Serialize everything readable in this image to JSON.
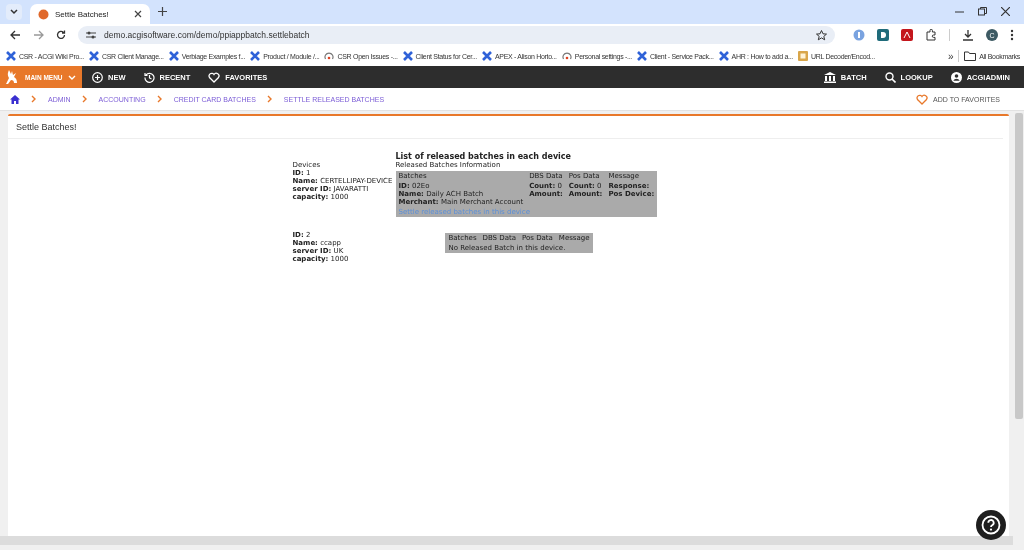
{
  "browser": {
    "tab_title": "Settle Batches!",
    "url": "demo.acgisoftware.com/demo/ppiappbatch.settlebatch",
    "bookmarks": [
      {
        "label": "CSR - ACGI Wiki Pro...",
        "kind": "cross"
      },
      {
        "label": "CSR Client Manage...",
        "kind": "cross"
      },
      {
        "label": "Verbiage Examples f...",
        "kind": "cross"
      },
      {
        "label": "Product / Module /...",
        "kind": "cross"
      },
      {
        "label": "CSR Open Issues -...",
        "kind": "arc"
      },
      {
        "label": "Client Status for Cer...",
        "kind": "cross"
      },
      {
        "label": "APEX - Alison Horto...",
        "kind": "cross"
      },
      {
        "label": "Personal settings -...",
        "kind": "arc"
      },
      {
        "label": "Client - Service Pack...",
        "kind": "cross"
      },
      {
        "label": "AHR : How to add a...",
        "kind": "cross"
      },
      {
        "label": "URL Decoder/Encod...",
        "kind": "square"
      }
    ],
    "more": "»",
    "all_bookmarks": "All Bookmarks",
    "profile": "C"
  },
  "nav": {
    "main_menu": "MAIN MENU",
    "left": [
      {
        "label": "NEW",
        "kind": "plus"
      },
      {
        "label": "RECENT",
        "kind": "history"
      },
      {
        "label": "FAVORITES",
        "kind": "heart"
      }
    ],
    "right": [
      {
        "label": "BATCH",
        "kind": "bank"
      },
      {
        "label": "LOOKUP",
        "kind": "search"
      },
      {
        "label": "ACGIADMIN",
        "kind": "user"
      }
    ]
  },
  "breadcrumb": [
    "ADMIN",
    "ACCOUNTING",
    "CREDIT CARD BATCHES",
    "SETTLE RELEASED BATCHES"
  ],
  "add_to_favorites": "ADD TO FAVORITES",
  "panel": {
    "title": "Settle Batches!",
    "heading": "List of released batches in each device",
    "devices_label": "Devices",
    "info_label": "Released Batches Information",
    "devices": [
      {
        "fields": [
          {
            "label": "ID:",
            "value": "1"
          },
          {
            "label": "Name:",
            "value": "CERTELLIPAY-DEVICE"
          },
          {
            "label": "server ID:",
            "value": "JAVARATTI"
          },
          {
            "label": "capacity:",
            "value": "1000"
          }
        ],
        "columns": [
          "Batches",
          "DBS Data",
          "Pos Data",
          "Message"
        ],
        "batches": [
          {
            "batch": [
              {
                "label": "ID:",
                "value": "02Eo"
              },
              {
                "label": "Name:",
                "value": "Daily ACH Batch"
              },
              {
                "label": "Merchant:",
                "value": "Main Merchant Account"
              }
            ],
            "dbs": [
              {
                "label": "Count:",
                "value": "0"
              },
              {
                "label": "Amount:"
              }
            ],
            "pos": [
              {
                "label": "Count:",
                "value": "0"
              },
              {
                "label": "Amount:"
              }
            ],
            "message": [
              {
                "label": "Response:"
              },
              {
                "label": "Pos Device:"
              }
            ]
          }
        ],
        "link": "Settle released batches in this device"
      },
      {
        "fields": [
          {
            "label": "ID:",
            "value": "2"
          },
          {
            "label": "Name:",
            "value": "ccapp"
          },
          {
            "label": "server ID:",
            "value": "UK"
          },
          {
            "label": "capacity:",
            "value": "1000"
          }
        ],
        "columns": [
          "Batches",
          "DBS Data",
          "Pos Data",
          "Message"
        ],
        "empty_message": "No Released Batch in this device."
      }
    ]
  }
}
